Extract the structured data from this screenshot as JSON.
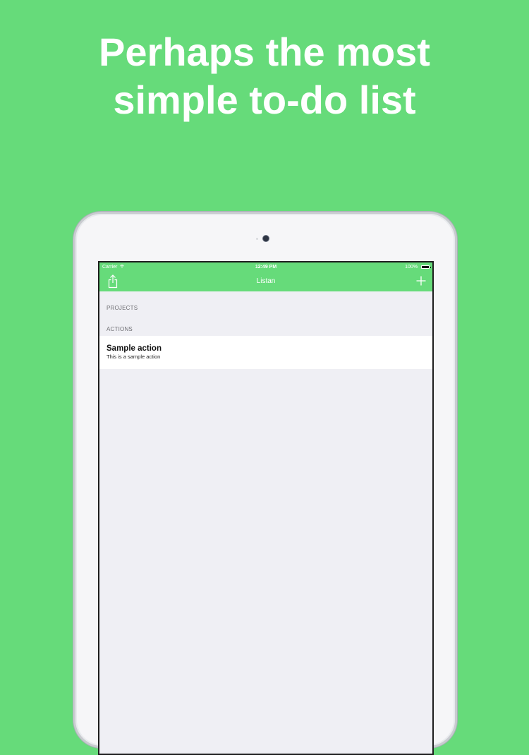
{
  "headline": {
    "line1": "Perhaps the most",
    "line2": "simple to-do list"
  },
  "statusbar": {
    "carrier": "Carrier",
    "time": "12:49 PM",
    "battery": "100%"
  },
  "navbar": {
    "title": "Listan",
    "share_icon": "share-icon",
    "add_icon": "plus-icon"
  },
  "sections": {
    "projects": "PROJECTS",
    "actions": "ACTIONS"
  },
  "actions": [
    {
      "title": "Sample action",
      "subtitle": "This is a sample action"
    }
  ],
  "colors": {
    "background": "#66db7a",
    "screen_background": "#efeff4",
    "accent": "#66db7a"
  }
}
